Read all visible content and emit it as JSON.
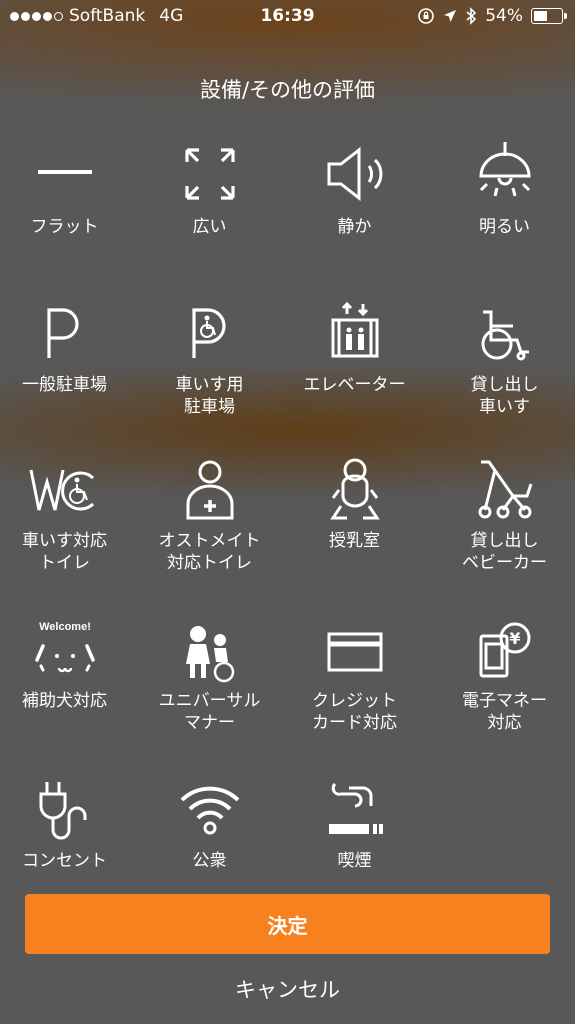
{
  "status_bar": {
    "carrier": "SoftBank",
    "network": "4G",
    "time": "16:39",
    "battery": "54%",
    "battery_level": 0.54,
    "signal_bars": 4,
    "signal_total": 5
  },
  "title": "設備/その他の評価",
  "items": [
    {
      "label": "フラット",
      "icon": "flat-line-icon"
    },
    {
      "label": "広い",
      "icon": "expand-arrows-icon"
    },
    {
      "label": "静か",
      "icon": "speaker-icon"
    },
    {
      "label": "明るい",
      "icon": "ceiling-lamp-icon"
    },
    {
      "label": "一般駐車場",
      "icon": "parking-icon"
    },
    {
      "label": "車いす用\n駐車場",
      "icon": "accessible-parking-icon"
    },
    {
      "label": "エレベーター",
      "icon": "elevator-icon"
    },
    {
      "label": "貸し出し\n車いす",
      "icon": "wheelchair-icon"
    },
    {
      "label": "車いす対応\nトイレ",
      "icon": "accessible-toilet-icon"
    },
    {
      "label": "オストメイト\n対応トイレ",
      "icon": "ostomate-icon"
    },
    {
      "label": "授乳室",
      "icon": "baby-icon"
    },
    {
      "label": "貸し出し\nベビーカー",
      "icon": "stroller-icon"
    },
    {
      "label": "補助犬対応",
      "icon": "assistance-dog-icon",
      "icon_text": "Welcome!"
    },
    {
      "label": "ユニバーサル\nマナー",
      "icon": "universal-manner-icon"
    },
    {
      "label": "クレジット\nカード対応",
      "icon": "credit-card-icon"
    },
    {
      "label": "電子マネー\n対応",
      "icon": "e-money-icon",
      "icon_text": "¥"
    },
    {
      "label": "コンセント",
      "icon": "power-plug-icon"
    },
    {
      "label": "公衆",
      "icon": "wifi-icon"
    },
    {
      "label": "喫煙",
      "icon": "smoking-icon"
    }
  ],
  "confirm_label": "決定",
  "cancel_label": "キャンセル",
  "colors": {
    "accent": "#f7811e",
    "background": "#585858"
  }
}
